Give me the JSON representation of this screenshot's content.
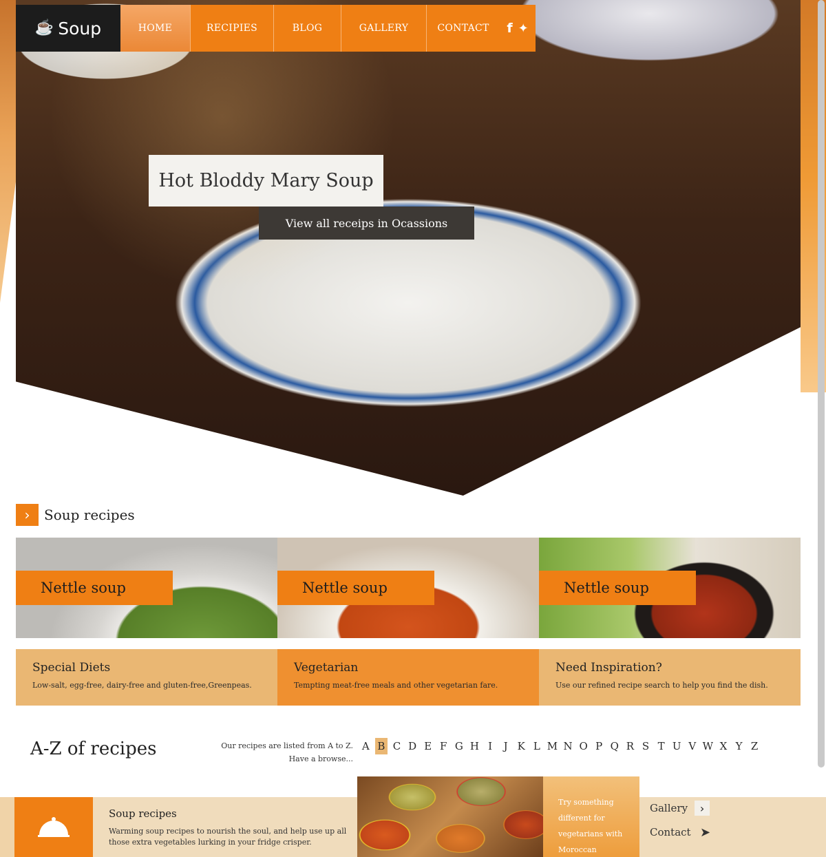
{
  "brand": {
    "logo_text": "Soup",
    "logo_icon": "soup-bowl-icon"
  },
  "nav": {
    "items": [
      {
        "label": "HOME",
        "active": true
      },
      {
        "label": "RECIPIES"
      },
      {
        "label": "BLOG"
      },
      {
        "label": "GALLERY"
      },
      {
        "label": "CONTACT"
      }
    ],
    "social": [
      "facebook-icon",
      "twitter-bird-icon"
    ]
  },
  "hero": {
    "title": "Hot Bloddy Mary Soup",
    "button_label": "View all receips in Ocassions"
  },
  "recipes_section": {
    "title": "Soup recipes"
  },
  "cards": [
    {
      "label": "Nettle soup"
    },
    {
      "label": "Nettle soup"
    },
    {
      "label": "Nettle soup"
    }
  ],
  "tiles": [
    {
      "title": "Special Diets",
      "desc": "Low-salt, egg-free, dairy-free and gluten-free,Greenpeas."
    },
    {
      "title": "Vegetarian",
      "desc": "Tempting meat-free meals and other vegetarian fare."
    },
    {
      "title": "Need Inspiration?",
      "desc": "Use our refined recipe search to help you find the dish."
    }
  ],
  "az": {
    "title": "A-Z of recipes",
    "intro": "Our recipes are listed from A to Z. Have a browse...",
    "letters": [
      "A",
      "B",
      "C",
      "D",
      "E",
      "F",
      "G",
      "H",
      "I",
      "J",
      "K",
      "L",
      "M",
      "N",
      "O",
      "P",
      "Q",
      "R",
      "S",
      "T",
      "U",
      "V",
      "W",
      "X",
      "Y",
      "Z"
    ],
    "active_letter": "B"
  },
  "footer": {
    "title": "Soup recipes",
    "desc": "Warming soup recipes to nourish the soul, and help use up all those extra vegetables lurking in your fridge crisper.",
    "promo": "Try something different for vegetarians with Moroccan",
    "links": [
      {
        "label": "Gallery",
        "icon": "chevron-right-icon"
      },
      {
        "label": "Contact",
        "icon": "paper-plane-icon"
      }
    ]
  },
  "colors": {
    "accent": "#ef7f14",
    "tile_light": "#eab773",
    "tile_mid": "#ef9030",
    "dark": "#1c1c1c"
  }
}
